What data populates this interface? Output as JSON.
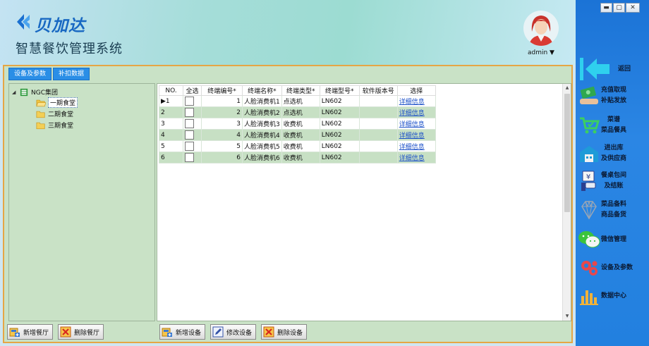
{
  "header": {
    "brand_name": "贝加达",
    "system_title": "智慧餐饮管理系统",
    "user": "admin ▼"
  },
  "window_controls": [
    "▬",
    "▢",
    "✕"
  ],
  "tabs": [
    "设备及参数",
    "补扣数据"
  ],
  "tree": {
    "root": "NGC集团",
    "children": [
      "一期食堂",
      "二期食堂",
      "三期食堂"
    ],
    "selected": "一期食堂"
  },
  "grid": {
    "columns": [
      "NO.",
      "全选",
      "终端编号*",
      "终端名称*",
      "终端类型*",
      "终端型号*",
      "软件版本号",
      "选择"
    ],
    "rows": [
      {
        "row": "1",
        "id": "1",
        "name": "人脸消费机1",
        "type": "点选机",
        "model": "LN602",
        "version": "",
        "link": "详细信息"
      },
      {
        "row": "2",
        "id": "2",
        "name": "人脸消费机2",
        "type": "点选机",
        "model": "LN602",
        "version": "",
        "link": "详细信息"
      },
      {
        "row": "3",
        "id": "3",
        "name": "人脸消费机3",
        "type": "收费机",
        "model": "LN602",
        "version": "",
        "link": "详细信息"
      },
      {
        "row": "4",
        "id": "4",
        "name": "人脸消费机4",
        "type": "收费机",
        "model": "LN602",
        "version": "",
        "link": "详细信息"
      },
      {
        "row": "5",
        "id": "5",
        "name": "人脸消费机5",
        "type": "收费机",
        "model": "LN602",
        "version": "",
        "link": "详细信息"
      },
      {
        "row": "6",
        "id": "6",
        "name": "人脸消费机6",
        "type": "收费机",
        "model": "LN602",
        "version": "",
        "link": "详细信息"
      }
    ]
  },
  "buttons": {
    "add_canteen": "新增餐厅",
    "delete_canteen": "删除餐厅",
    "add_device": "新增设备",
    "edit_device": "修改设备",
    "delete_device": "删除设备"
  },
  "nav": [
    {
      "label1": "返回",
      "label2": "",
      "icon": "back-arrow-icon"
    },
    {
      "label1": "充值取现",
      "label2": "补贴发放",
      "icon": "money-icon"
    },
    {
      "label1": "菜谱",
      "label2": "菜品餐具",
      "icon": "cart-icon"
    },
    {
      "label1": "进出库",
      "label2": "及供应商",
      "icon": "warehouse-icon"
    },
    {
      "label1": "餐桌包间",
      "label2": "及结账",
      "icon": "yen-hand-icon"
    },
    {
      "label1": "菜品备料",
      "label2": "商品备货",
      "icon": "diamond-icon"
    },
    {
      "label1": "微信管理",
      "label2": "",
      "icon": "wechat-icon"
    },
    {
      "label1": "设备及参数",
      "label2": "",
      "icon": "gears-icon"
    },
    {
      "label1": "数据中心",
      "label2": "",
      "icon": "bar-chart-icon"
    }
  ],
  "colors": {
    "nav_bg": "#2280df",
    "tab_bg": "#2a8ee6",
    "panel_bg": "#c9e2c6",
    "panel_border": "#e5a645",
    "link": "#1a4fc8",
    "brand": "#1868c2"
  }
}
